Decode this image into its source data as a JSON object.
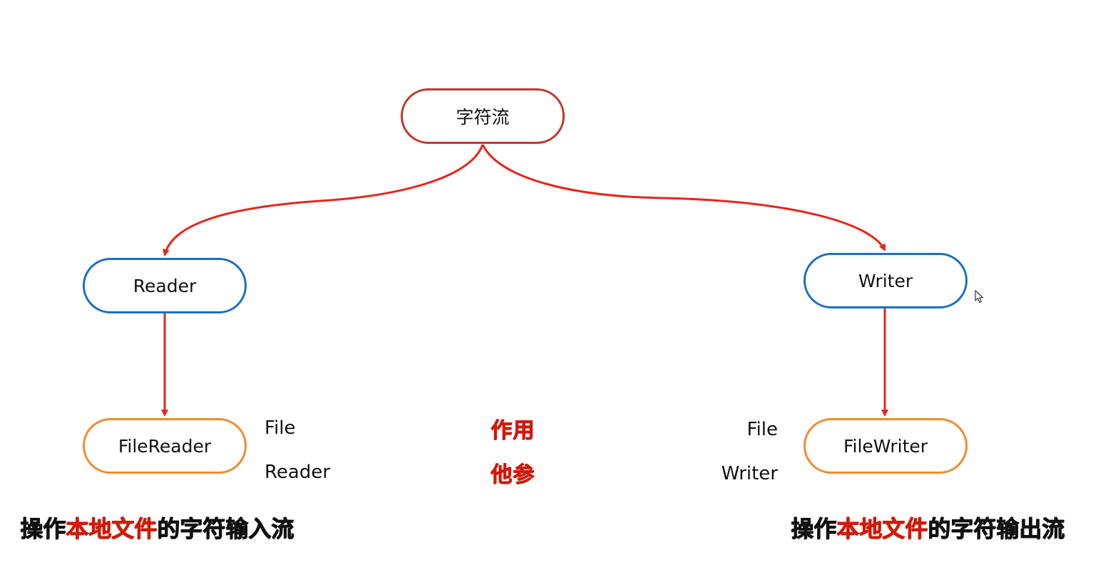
{
  "diagram": {
    "root": {
      "label": "字符流"
    },
    "reader": {
      "label": "Reader"
    },
    "writer": {
      "label": "Writer"
    },
    "file_reader": {
      "label": "FileReader"
    },
    "file_writer": {
      "label": "FileWriter"
    },
    "left_words": [
      "File",
      "Reader"
    ],
    "right_words": [
      "File",
      "Writer"
    ],
    "middle_labels": [
      "作用",
      "他参"
    ],
    "left_caption": {
      "pre": "操作",
      "highlight": "本地文件",
      "post": "的字符输入流"
    },
    "right_caption": {
      "pre": "操作",
      "highlight": "本地文件",
      "post": "的字符输出流"
    }
  },
  "colors": {
    "arrow": "#e8241a",
    "root_border": "#c0392b",
    "parent_border": "#1a6fc4",
    "child_border": "#f28a2e",
    "highlight_text": "#d0190a"
  }
}
